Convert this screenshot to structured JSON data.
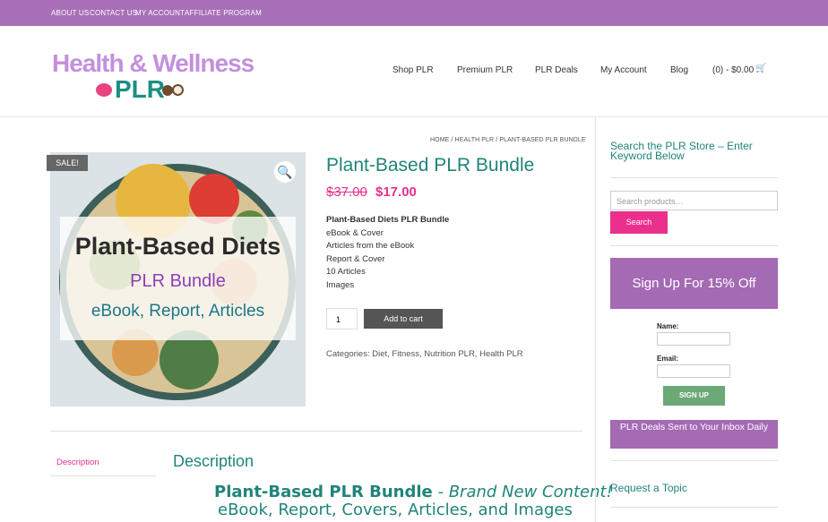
{
  "topbar": {
    "about": "ABOUT US",
    "contact": "CONTACT US",
    "account": "MY ACCOUNT",
    "affiliate": "AFFILIATE PROGRAM"
  },
  "logo": {
    "line1": "Health & Wellness",
    "line2": "PLR"
  },
  "nav": {
    "shop": "Shop PLR",
    "premium": "Premium PLR",
    "deals": "PLR Deals",
    "account": "My Account",
    "blog": "Blog",
    "cart": "(0) - $0.00"
  },
  "breadcrumb": "HOME / HEALTH PLR / PLANT-BASED PLR BUNDLE",
  "product": {
    "sale_badge": "SALE!",
    "image_title": "Plant-Based Diets",
    "image_subtitle": "PLR Bundle",
    "image_tagline": "eBook, Report, Articles",
    "title": "Plant-Based PLR Bundle",
    "old_price": "$37.00",
    "new_price": "$17.00",
    "desc_bold": "Plant-Based Diets PLR Bundle",
    "desc_lines": [
      "eBook & Cover",
      "Articles from the eBook",
      "Report & Cover",
      "10 Articles",
      "Images"
    ],
    "qty": "1",
    "cart_label": "Add to cart",
    "categories_label": "Categories:",
    "categories": "Diet, Fitness, Nutrition PLR, Health PLR"
  },
  "tabs": {
    "description": "Description"
  },
  "content": {
    "heading": "Description",
    "line1_bold": "Plant-Based PLR Bundle",
    "line1_rest": " - Brand New Content!",
    "line2": "eBook, Report, Covers, Articles, and Images"
  },
  "sidebar": {
    "search_title": "Search the PLR Store – Enter Keyword Below",
    "search_placeholder": "Search products…",
    "search_button": "Search",
    "signup_title": "Sign Up For 15% Off",
    "name_label": "Name:",
    "email_label": "Email:",
    "signup_button": "SIGN UP",
    "deals_text": "PLR Deals Sent to Your Inbox Daily",
    "request": "Request a Topic"
  },
  "colors": {
    "topbar": "#a86fb8",
    "teal": "#20847a",
    "pink": "#e72f90",
    "purple": "#a46ab4"
  }
}
